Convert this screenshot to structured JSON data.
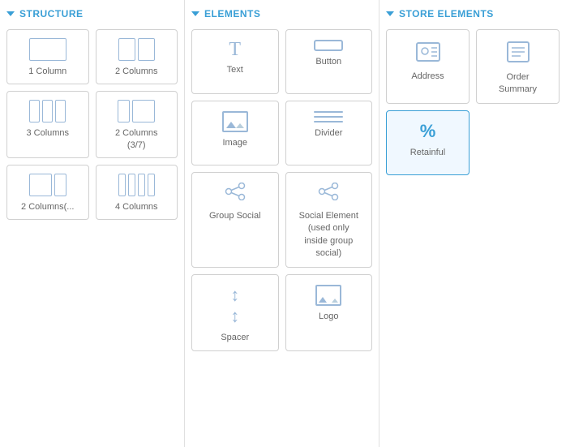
{
  "structure": {
    "header": "STRUCTURE",
    "items": [
      {
        "id": "1col",
        "label": "1 Column",
        "cols": 1
      },
      {
        "id": "2col",
        "label": "2 Columns",
        "cols": 2
      },
      {
        "id": "3col",
        "label": "3 Columns",
        "cols": 3
      },
      {
        "id": "2col37",
        "label": "2 Columns\n(3/7)",
        "cols": 2,
        "variant": "37"
      },
      {
        "id": "2col-left",
        "label": "2 Columns(...",
        "cols": 2,
        "variant": "left"
      },
      {
        "id": "4col",
        "label": "4 Columns",
        "cols": 4
      }
    ]
  },
  "elements": {
    "header": "ELEMENTS",
    "items": [
      {
        "id": "text",
        "label": "Text",
        "icon": "text"
      },
      {
        "id": "button",
        "label": "Button",
        "icon": "button"
      },
      {
        "id": "image",
        "label": "Image",
        "icon": "image"
      },
      {
        "id": "divider",
        "label": "Divider",
        "icon": "divider"
      },
      {
        "id": "group-social",
        "label": "Group Social",
        "icon": "social"
      },
      {
        "id": "social-element",
        "label": "Social Element\n(used only inside group social)",
        "icon": "social"
      },
      {
        "id": "spacer",
        "label": "Spacer",
        "icon": "spacer"
      },
      {
        "id": "logo",
        "label": "Logo",
        "icon": "logo"
      }
    ]
  },
  "store": {
    "header": "STORE ELEMENTS",
    "items": [
      {
        "id": "address",
        "label": "Address",
        "icon": "address"
      },
      {
        "id": "order-summary",
        "label": "Order Summary",
        "icon": "order-summary"
      },
      {
        "id": "retainful",
        "label": "Retainful",
        "icon": "percent",
        "highlight": true
      }
    ]
  }
}
